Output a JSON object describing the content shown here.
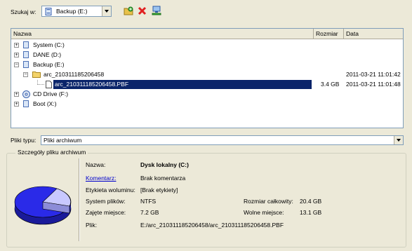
{
  "toolbar": {
    "look_in_label": "Szukaj w:",
    "location_value": "Backup (E:)",
    "icons": [
      "new-folder-icon",
      "delete-icon",
      "network-icon"
    ]
  },
  "tree": {
    "columns": [
      "Nazwa",
      "Rozmiar",
      "Data"
    ],
    "rows": [
      {
        "name": "System (C:)",
        "size": "",
        "date": ""
      },
      {
        "name": "DANE (D:)",
        "size": "",
        "date": ""
      },
      {
        "name": "Backup (E:)",
        "size": "",
        "date": ""
      },
      {
        "name": "arc_210311185206458",
        "size": "",
        "date": "2011-03-21 11:01:42"
      },
      {
        "name": "arc_210311185206458.PBF",
        "size": "3.4 GB",
        "date": "2011-03-21 11:01:48"
      },
      {
        "name": "CD Drive (F:)",
        "size": "",
        "date": ""
      },
      {
        "name": "Boot (X:)",
        "size": "",
        "date": ""
      }
    ]
  },
  "file_type": {
    "label": "Pliki typu:",
    "value": "Pliki archiwum"
  },
  "details": {
    "title": "Szczegóły pliku archiwum",
    "name_label": "Nazwa:",
    "name_value": "Dysk lokalny (C:)",
    "comment_label": "Komentarz:",
    "comment_value": "Brak komentarza",
    "volume_label_label": "Etykieta woluminu:",
    "volume_label_value": "[Brak etykiety]",
    "fs_label": "System plików:",
    "fs_value": "NTFS",
    "used_label": "Zajęte miejsce:",
    "used_value": "7.2 GB",
    "file_label": "Plik:",
    "file_value": "E:/arc_210311185206458/arc_210311185206458.PBF",
    "total_label": "Rozmiar całkowity:",
    "total_value": "20.4 GB",
    "free_label": "Wolne miejsce:",
    "free_value": "13.1 GB",
    "colors": {
      "used": "#2a2ae8",
      "free": "#c8c8ff"
    }
  }
}
